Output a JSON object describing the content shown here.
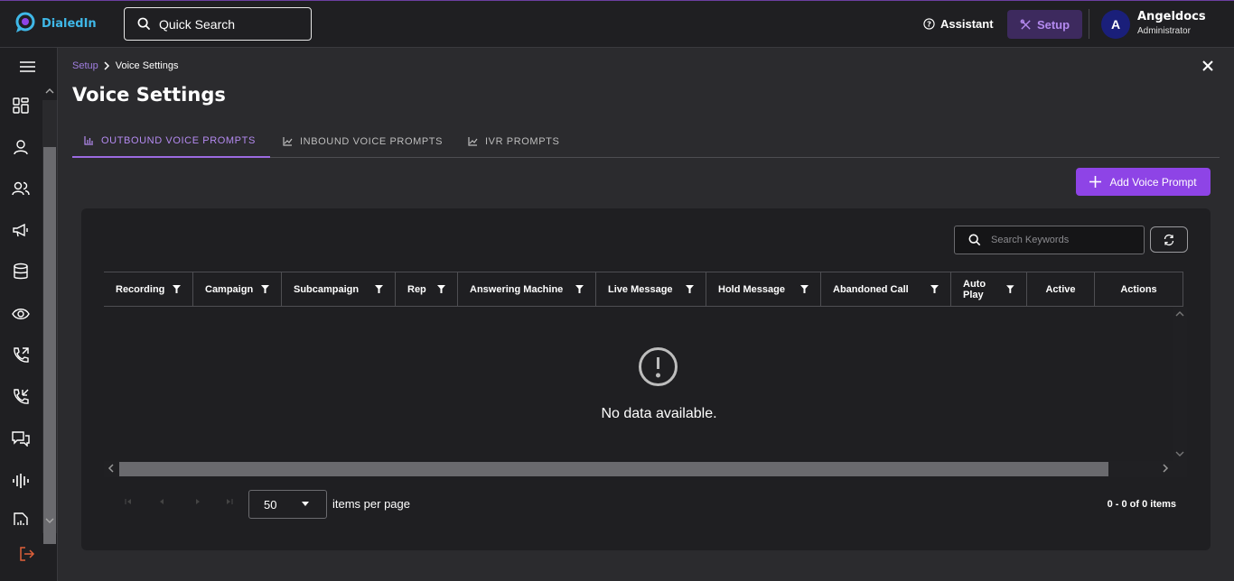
{
  "app": {
    "logo_text": "DialedIn"
  },
  "header": {
    "quick_search_label": "Quick Search",
    "assistant_label": "Assistant",
    "setup_label": "Setup",
    "avatar_initial": "A",
    "user_name": "Angeldocs",
    "user_role": "Administrator"
  },
  "breadcrumb": {
    "parent": "Setup",
    "current": "Voice Settings"
  },
  "page": {
    "title": "Voice Settings"
  },
  "tabs": [
    {
      "label": "OUTBOUND VOICE PROMPTS",
      "active": true
    },
    {
      "label": "INBOUND VOICE PROMPTS",
      "active": false
    },
    {
      "label": "IVR PROMPTS",
      "active": false
    }
  ],
  "actions": {
    "add_label": "Add Voice Prompt"
  },
  "table": {
    "search_placeholder": "Search Keywords",
    "columns": [
      {
        "label": "Recording",
        "filter": true
      },
      {
        "label": "Campaign",
        "filter": true
      },
      {
        "label": "Subcampaign",
        "filter": true
      },
      {
        "label": "Rep",
        "filter": true
      },
      {
        "label": "Answering Machine",
        "filter": true
      },
      {
        "label": "Live Message",
        "filter": true
      },
      {
        "label": "Hold Message",
        "filter": true
      },
      {
        "label": "Abandoned Call",
        "filter": true
      },
      {
        "label": "Auto Play",
        "filter": true
      },
      {
        "label": "Active",
        "filter": false
      },
      {
        "label": "Actions",
        "filter": false
      }
    ],
    "empty_message": "No data available.",
    "page_size": "50",
    "items_per_page_label": "items per page",
    "count_label": "0 - 0 of 0 items"
  },
  "colors": {
    "accent": "#8e44e6",
    "accent_text": "#b48af0",
    "panel": "#1f1f22",
    "background": "#2b2b2e",
    "logout": "#e0603a"
  },
  "icons": {
    "sidebar": [
      "dashboard-icon",
      "user-icon",
      "users-icon",
      "megaphone-icon",
      "database-icon",
      "eye-icon",
      "outbound-call-icon",
      "inbound-call-icon",
      "chat-icon",
      "audio-wave-icon",
      "report-icon"
    ]
  }
}
